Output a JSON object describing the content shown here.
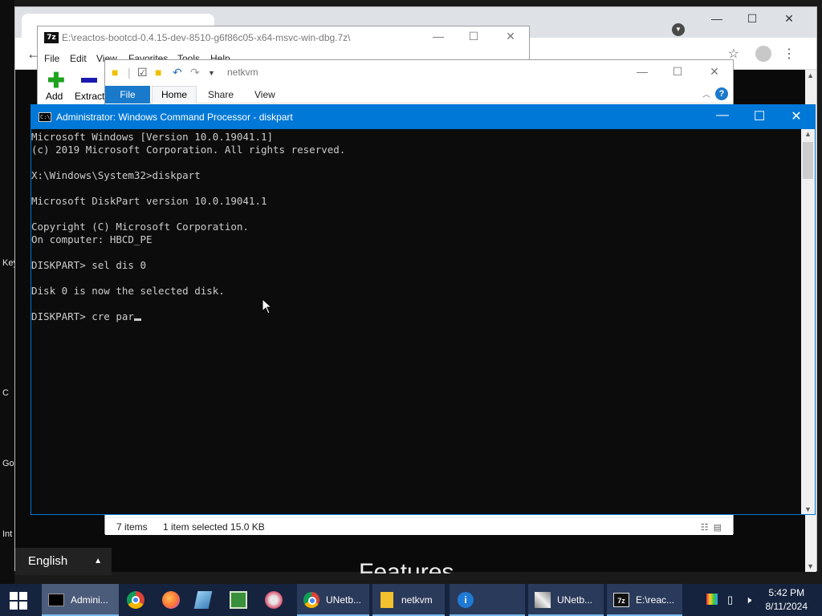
{
  "desktop": {
    "left_labels": [
      "Key",
      "C",
      "Go",
      "Int"
    ]
  },
  "chrome": {
    "english_label": "English",
    "page_heading": "Features"
  },
  "sevenzip": {
    "icon_text": "7z",
    "title": "E:\\reactos-bootcd-0.4.15-dev-8510-g6f86c05-x64-msvc-win-dbg.7z\\",
    "menu": [
      "File",
      "Edit",
      "View",
      "Favorites",
      "Tools",
      "Help"
    ],
    "add_label": "Add",
    "extract_label": "Extract"
  },
  "explorer": {
    "title": "netkvm",
    "tabs": {
      "file": "File",
      "home": "Home",
      "share": "Share",
      "view": "View"
    },
    "help": "?",
    "status_items": "7 items",
    "status_selected": "1 item selected  15.0 KB"
  },
  "cmd": {
    "icon_text": "C:\\",
    "title": "Administrator: Windows Command Processor - diskpart",
    "lines": [
      "Microsoft Windows [Version 10.0.19041.1]",
      "(c) 2019 Microsoft Corporation. All rights reserved.",
      "",
      "X:\\Windows\\System32>diskpart",
      "",
      "Microsoft DiskPart version 10.0.19041.1",
      "",
      "Copyright (C) Microsoft Corporation.",
      "On computer: HBCD_PE",
      "",
      "DISKPART> sel dis 0",
      "",
      "Disk 0 is now the selected disk.",
      "",
      "DISKPART> cre par"
    ]
  },
  "taskbar": {
    "buttons": [
      {
        "label": "Admini...",
        "icon": "cmd-icon"
      },
      {
        "label": "UNetb...",
        "icon": "chrome-icon"
      },
      {
        "label": "netkvm",
        "icon": "folder-icon"
      },
      {
        "label": "",
        "icon": "info-icon"
      },
      {
        "label": "UNetb...",
        "icon": "unetbootin-icon"
      },
      {
        "label": "E:\\reac...",
        "icon": "7zip-icon"
      }
    ],
    "time": "5:42 PM",
    "date": "8/11/2024"
  },
  "colors": {
    "cmd_titlebar": "#0078d7",
    "taskbar": "#15233f",
    "explorer_file_tab": "#1979ca"
  }
}
